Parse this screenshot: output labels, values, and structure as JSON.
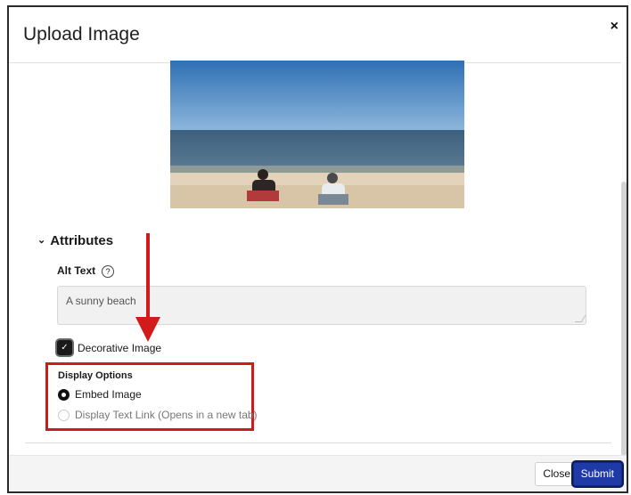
{
  "modal": {
    "title": "Upload Image",
    "close_glyph": "×"
  },
  "image": {
    "description_icon": "beach-photo"
  },
  "attributes": {
    "heading": "Attributes",
    "chevron": "⌄",
    "alt_text_label": "Alt Text",
    "help_glyph": "?",
    "alt_text_value": "A sunny beach",
    "decorative_label": "Decorative Image",
    "decorative_checked": true,
    "checkmark": "✓"
  },
  "display_options": {
    "title": "Display Options",
    "options": [
      {
        "label": "Embed Image",
        "selected": true
      },
      {
        "label": "Display Text Link (Opens in a new tab)",
        "selected": false
      }
    ]
  },
  "footer": {
    "close_label": "Close",
    "submit_label": "Submit"
  },
  "colors": {
    "highlight": "#d31a1a",
    "submit": "#1f39a6"
  }
}
